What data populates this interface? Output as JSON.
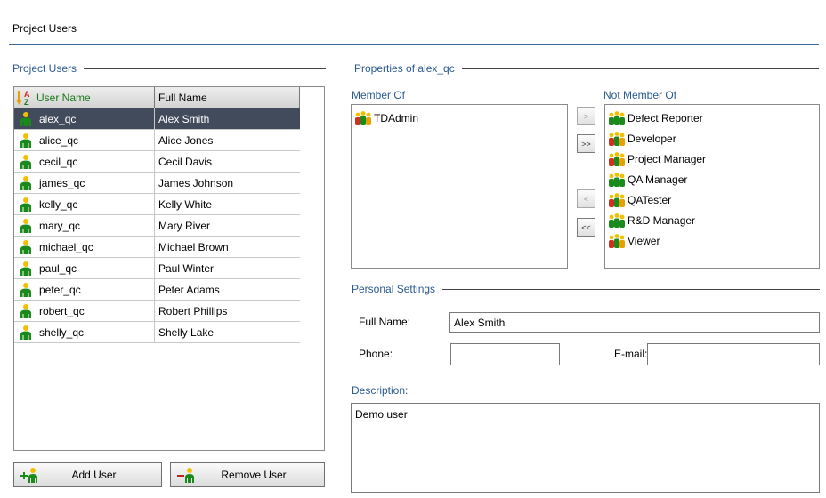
{
  "page": {
    "title": "Project Users"
  },
  "users_panel": {
    "group_label": "Project Users",
    "columns": {
      "user_name": "User Name",
      "full_name": "Full Name"
    },
    "rows": [
      {
        "user": "alex_qc",
        "full": "Alex Smith",
        "selected": true
      },
      {
        "user": "alice_qc",
        "full": "Alice Jones"
      },
      {
        "user": "cecil_qc",
        "full": "Cecil Davis"
      },
      {
        "user": "james_qc",
        "full": "James Johnson"
      },
      {
        "user": "kelly_qc",
        "full": "Kelly White"
      },
      {
        "user": "mary_qc",
        "full": "Mary River"
      },
      {
        "user": "michael_qc",
        "full": "Michael Brown"
      },
      {
        "user": "paul_qc",
        "full": "Paul Winter"
      },
      {
        "user": "peter_qc",
        "full": "Peter Adams"
      },
      {
        "user": "robert_qc",
        "full": "Robert Phillips"
      },
      {
        "user": "shelly_qc",
        "full": "Shelly Lake"
      }
    ],
    "add_button": "Add User",
    "remove_button": "Remove User"
  },
  "properties": {
    "group_label": "Properties of alex_qc",
    "member_of_label": "Member Of",
    "not_member_of_label": "Not Member Of",
    "member_of": [
      "TDAdmin"
    ],
    "not_member_of": [
      "Defect Reporter",
      "Developer",
      "Project Manager",
      "QA Manager",
      "QATester",
      "R&D Manager",
      "Viewer"
    ],
    "group_icons": {
      "TDAdmin": "mixed-group-icon",
      "Defect Reporter": "green-group-icon",
      "Developer": "mixed-group-icon",
      "Project Manager": "mixed-group-icon",
      "QA Manager": "green-group-icon",
      "QATester": "mixed-group-icon",
      "R&D Manager": "green-group-icon",
      "Viewer": "mixed-group-icon"
    },
    "move_buttons": {
      "add_one": ">",
      "add_all": ">>",
      "remove_one": "<",
      "remove_all": "<<"
    }
  },
  "personal": {
    "group_label": "Personal Settings",
    "full_name_label": "Full Name:",
    "full_name_value": "Alex Smith",
    "phone_label": "Phone:",
    "phone_value": "",
    "email_label": "E-mail:",
    "email_value": "",
    "description_label": "Description:",
    "description_value": "Demo user"
  },
  "colors": {
    "accent": "#2b5a8f",
    "selected_row": "#424b5c",
    "user_name_header": "#1a7a1a"
  }
}
